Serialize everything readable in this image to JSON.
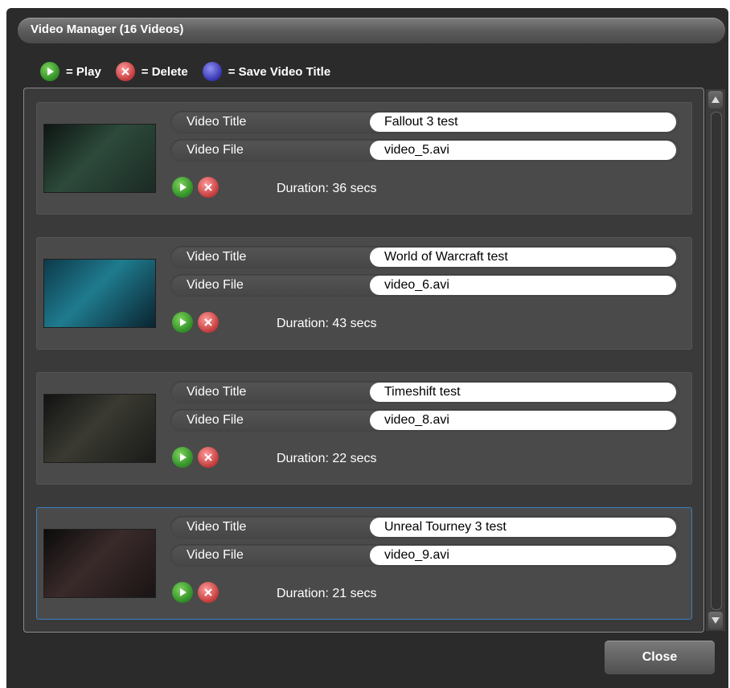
{
  "window": {
    "title": "Video Manager (16 Videos)"
  },
  "legend": {
    "play": {
      "icon": "play-icon",
      "label": "= Play",
      "color": "#3f9e2f"
    },
    "delete": {
      "icon": "delete-icon",
      "label": "= Delete",
      "color": "#d04848"
    },
    "save": {
      "icon": "save-icon",
      "label": "= Save Video Title",
      "color": "#4545c8"
    }
  },
  "videos": [
    {
      "title_label": "Video Title",
      "title_value": "Fallout 3 test",
      "file_label": "Video File",
      "file_value": "video_5.avi",
      "duration": "Duration: 36 secs",
      "thumb_palette": [
        "#0e1512",
        "#2d4a3b",
        "#1b2a24"
      ]
    },
    {
      "title_label": "Video Title",
      "title_value": "World of Warcraft test",
      "file_label": "Video File",
      "file_value": "video_6.avi",
      "duration": "Duration: 43 secs",
      "thumb_palette": [
        "#0d3a4a",
        "#1f7b8e",
        "#0a2330"
      ]
    },
    {
      "title_label": "Video Title",
      "title_value": "Timeshift test",
      "file_label": "Video File",
      "file_value": "video_8.avi",
      "duration": "Duration: 22 secs",
      "thumb_palette": [
        "#121212",
        "#3a3a32",
        "#1a1a18"
      ]
    },
    {
      "title_label": "Video Title",
      "title_value": "Unreal Tourney 3 test",
      "file_label": "Video File",
      "file_value": "video_9.avi",
      "duration": "Duration: 21 secs",
      "thumb_palette": [
        "#0b0b0b",
        "#3a2a2a",
        "#1a1414"
      ]
    }
  ],
  "footer": {
    "close_label": "Close"
  },
  "colors": {
    "selected_border": "#3b7fc4",
    "card_bg": "#4a4a4a",
    "window_bg": "#2b2b2b"
  }
}
